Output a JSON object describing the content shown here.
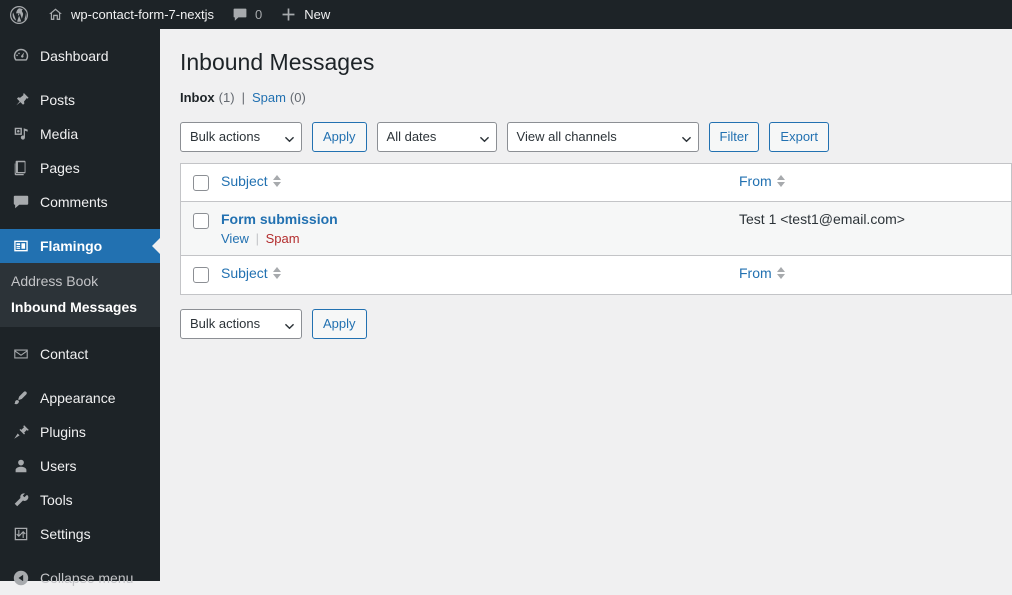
{
  "adminbar": {
    "wp_logo": "wordpress-logo-icon",
    "site_name": "wp-contact-form-7-nextjs",
    "site_icon": "home-icon",
    "comments_icon": "comment-bubble-icon",
    "comments_count": "0",
    "new_icon": "plus-icon",
    "new_label": "New"
  },
  "sidebar": {
    "items": [
      {
        "label": "Dashboard",
        "icon": "dashboard-icon",
        "current": false
      },
      {
        "label": "Posts",
        "icon": "pin-icon",
        "current": false
      },
      {
        "label": "Media",
        "icon": "media-icon",
        "current": false
      },
      {
        "label": "Pages",
        "icon": "pages-icon",
        "current": false
      },
      {
        "label": "Comments",
        "icon": "comment-bubble-icon",
        "current": false
      },
      {
        "label": "Flamingo",
        "icon": "flamingo-icon",
        "current": true
      },
      {
        "label": "Contact",
        "icon": "envelope-icon",
        "current": false
      },
      {
        "label": "Appearance",
        "icon": "brush-icon",
        "current": false
      },
      {
        "label": "Plugins",
        "icon": "plug-icon",
        "current": false
      },
      {
        "label": "Users",
        "icon": "user-icon",
        "current": false
      },
      {
        "label": "Tools",
        "icon": "wrench-icon",
        "current": false
      },
      {
        "label": "Settings",
        "icon": "settings-sliders-icon",
        "current": false
      }
    ],
    "submenu": [
      {
        "label": "Address Book",
        "current": false
      },
      {
        "label": "Inbound Messages",
        "current": true
      }
    ],
    "collapse": {
      "label": "Collapse menu",
      "icon": "collapse-arrow-icon"
    }
  },
  "main": {
    "page_title": "Inbound Messages",
    "views": {
      "inbox_label": "Inbox",
      "inbox_count": "(1)",
      "separator": "|",
      "spam_label": "Spam",
      "spam_count": "(0)"
    },
    "tablenav_top": {
      "bulk_actions_value": "Bulk actions",
      "apply_label": "Apply",
      "dates_value": "All dates",
      "channels_value": "View all channels",
      "filter_label": "Filter",
      "export_label": "Export"
    },
    "tablenav_bottom": {
      "bulk_actions_value": "Bulk actions",
      "apply_label": "Apply"
    },
    "table": {
      "columns": [
        {
          "key": "subject",
          "label": "Subject",
          "sortable": true
        },
        {
          "key": "from",
          "label": "From",
          "sortable": true
        }
      ],
      "rows": [
        {
          "subject": "Form submission",
          "actions": {
            "view": "View",
            "sep": "|",
            "spam": "Spam"
          },
          "from": "Test 1 <test1@email.com>"
        }
      ]
    }
  },
  "colors": {
    "admin_bar_bg": "#1d2327",
    "menu_bg": "#1d2327",
    "submenu_bg": "#2c3338",
    "accent_blue": "#2271b1",
    "spam_red": "#b32d2e",
    "content_bg": "#f0f0f1",
    "row_alt_bg": "#f6f7f7",
    "border_gray": "#c3c4c7"
  }
}
